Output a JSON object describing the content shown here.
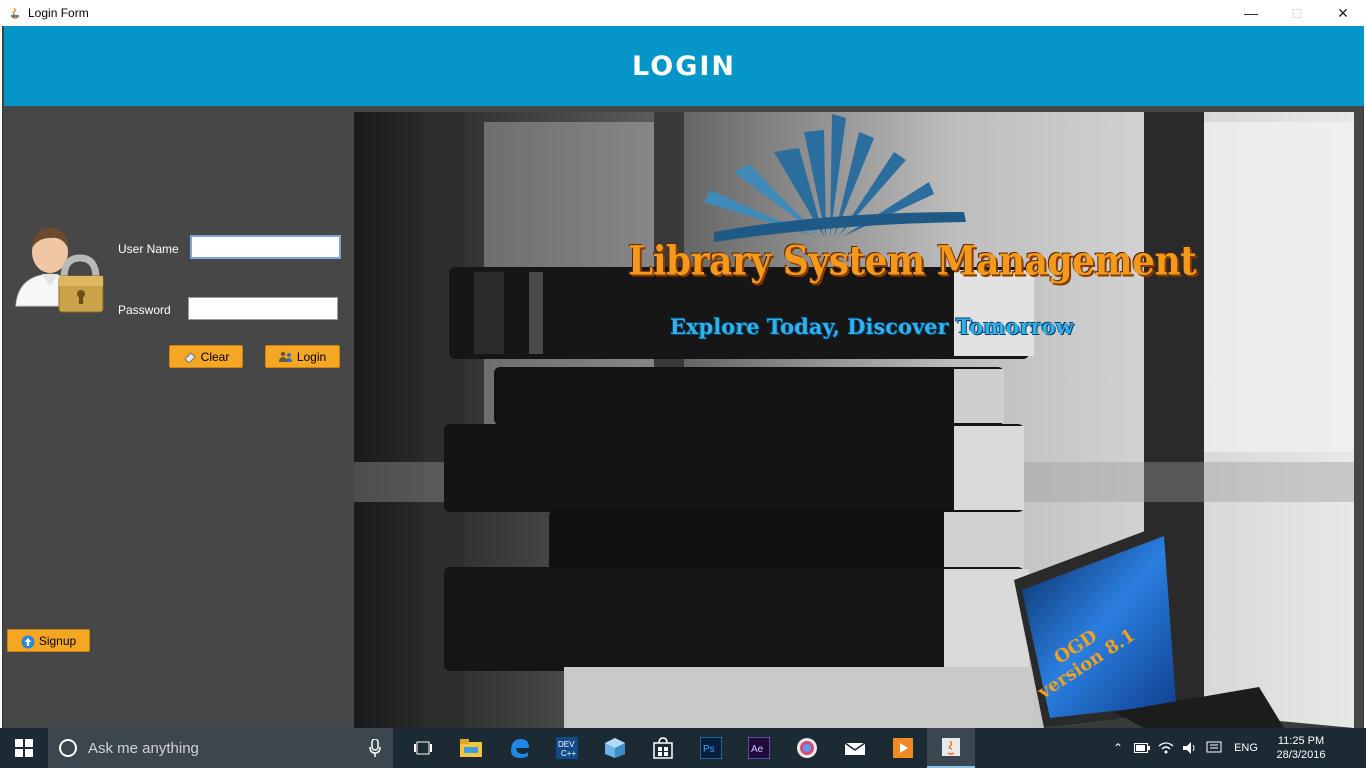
{
  "window": {
    "title": "Login Form"
  },
  "header": {
    "title": "LOGIN"
  },
  "form": {
    "username_label": "User Name",
    "username_value": "",
    "password_label": "Password",
    "password_value": "",
    "clear_label": "Clear",
    "login_label": "Login",
    "signup_label": "Signup"
  },
  "banner": {
    "title": "Library System Management",
    "tagline": "Explore Today, Discover Tomorrow",
    "laptop_line1": "OGD",
    "laptop_line2": "version 8.1"
  },
  "taskbar": {
    "search_placeholder": "Ask me anything",
    "language": "ENG",
    "time": "11:25 PM",
    "date": "28/3/2016",
    "icons": [
      "task-view",
      "file-explorer",
      "edge",
      "dev-cpp",
      "3d-box",
      "store",
      "photoshop",
      "after-effects",
      "chrome-like",
      "mail",
      "media-player",
      "java"
    ]
  },
  "colors": {
    "header": "#0596c9",
    "panel": "#474747",
    "button": "#f5a623",
    "taskbar": "#1c2a34"
  }
}
